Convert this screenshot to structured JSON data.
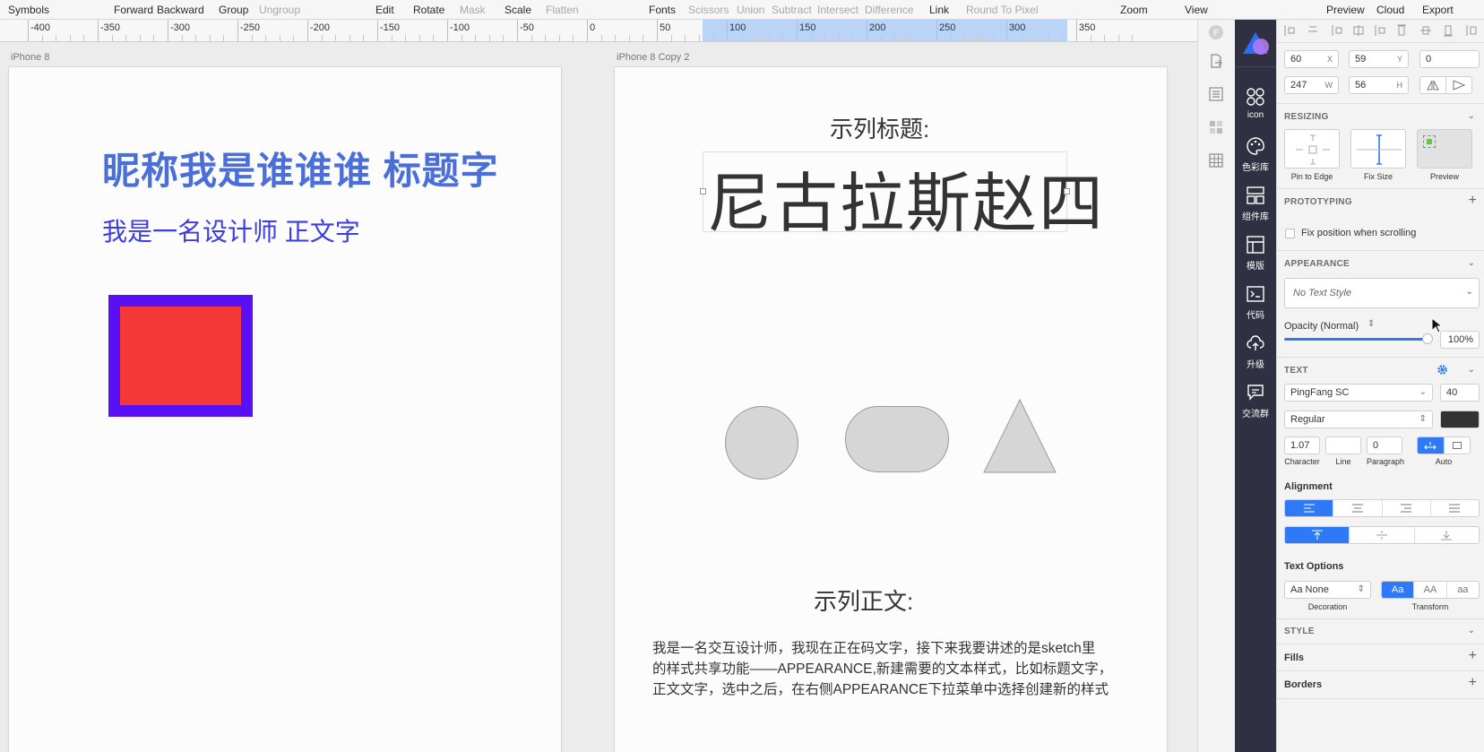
{
  "toolbar": {
    "symbols": "Symbols",
    "forward": "Forward",
    "backward": "Backward",
    "group": "Group",
    "ungroup": "Ungroup",
    "edit": "Edit",
    "rotate": "Rotate",
    "mask": "Mask",
    "scale": "Scale",
    "flatten": "Flatten",
    "fonts": "Fonts",
    "scissors": "Scissors",
    "union": "Union",
    "subtract": "Subtract",
    "intersect": "Intersect",
    "difference": "Difference",
    "link": "Link",
    "round_to_pixel": "Round To Pixel",
    "zoom": "Zoom",
    "view": "View",
    "preview": "Preview",
    "cloud": "Cloud",
    "export": "Export"
  },
  "ruler": {
    "labels": [
      "-400",
      "-350",
      "-300",
      "-250",
      "-200",
      "-150",
      "-100",
      "-50",
      "0",
      "50",
      "100",
      "150",
      "200",
      "250",
      "300",
      "350"
    ]
  },
  "artboards": {
    "left": {
      "name": "iPhone 8",
      "heading": "昵称我是谁谁谁 标题字",
      "body": "我是一名设计师 正文字"
    },
    "right": {
      "name": "iPhone 8 Copy 2",
      "sample_title_label": "示列标题:",
      "selected_text": "尼古拉斯赵四",
      "sample_body_label": "示列正文:",
      "paragraph_lines": [
        "我是一名交互设计师，我现在正在码文字，接下来我要讲述的是sketch里",
        "的样式共享功能——APPEARANCE,新建需要的文本样式，比如标题文字，",
        "正文文字，选中之后，在右侧APPEARANCE下拉菜单中选择创建新的样式"
      ]
    }
  },
  "plugin": {
    "items": [
      {
        "icon": "grid-icon",
        "label": "icon"
      },
      {
        "icon": "palette-icon",
        "label": "色彩库"
      },
      {
        "icon": "components-icon",
        "label": "组件库"
      },
      {
        "icon": "template-icon",
        "label": "模版"
      },
      {
        "icon": "code-icon",
        "label": "代码"
      },
      {
        "icon": "upload-cloud-icon",
        "label": "升级"
      },
      {
        "icon": "chat-icon",
        "label": "交流群"
      }
    ]
  },
  "inspector": {
    "position": {
      "x": "60",
      "x_suffix": "X",
      "y": "59",
      "y_suffix": "Y",
      "rotation": "0"
    },
    "size": {
      "w": "247",
      "w_suffix": "W",
      "h": "56",
      "h_suffix": "H"
    },
    "resizing": {
      "title": "RESIZING",
      "pin_to_edge": "Pin to Edge",
      "fix_size": "Fix Size",
      "preview": "Preview"
    },
    "prototyping": {
      "title": "PROTOTYPING",
      "fix_position": "Fix position when scrolling"
    },
    "appearance": {
      "title": "APPEARANCE",
      "text_style": "No Text Style",
      "opacity_label": "Opacity (Normal)",
      "opacity_value": "100%",
      "opacity": 1.0
    },
    "text": {
      "title": "TEXT",
      "font": "PingFang SC",
      "size": "40",
      "weight": "Regular",
      "character": "1.07",
      "line": "",
      "paragraph": "0",
      "character_label": "Character",
      "line_label": "Line",
      "paragraph_label": "Paragraph",
      "auto_label": "Auto",
      "alignment_title": "Alignment",
      "text_options_title": "Text Options",
      "decoration": "Aa None",
      "decoration_label": "Decoration",
      "transform_label": "Transform",
      "transform_options": [
        "Aa",
        "AA",
        "aa"
      ]
    },
    "style": {
      "title": "STYLE",
      "fills": "Fills",
      "borders": "Borders"
    }
  },
  "colors": {
    "heading_blue": "#4a6fd8",
    "body_blue": "#3b3de0",
    "square_border": "#5a10f5",
    "square_fill": "#f43838",
    "shape_fill": "#d6d6d6",
    "accent": "#2f79f6",
    "plugin_bg": "#2f3042"
  }
}
